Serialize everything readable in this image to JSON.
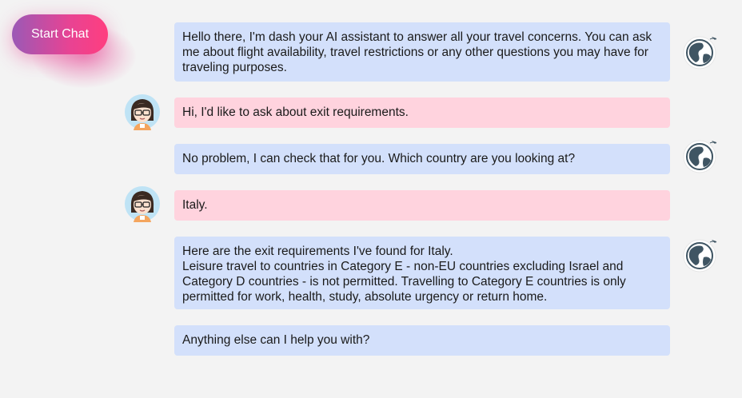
{
  "start_button": {
    "label": "Start Chat"
  },
  "messages": [
    {
      "from": "bot",
      "text": "Hello there, I'm dash your AI assistant to answer all your travel concerns. You can ask me about flight availability, travel restrictions or any other questions you may have for traveling purposes."
    },
    {
      "from": "user",
      "text": "Hi, I'd like to ask about exit requirements."
    },
    {
      "from": "bot",
      "text": "No problem, I can check that for you. Which country are you looking at?"
    },
    {
      "from": "user",
      "text": "Italy."
    },
    {
      "from": "bot",
      "text": "Here are the exit requirements I've found for Italy.\nLeisure travel to countries in Category E - non-EU countries excluding Israel and Category D countries - is not permitted. Travelling to Category E countries is only permitted for work, health, study, absolute urgency or return home."
    },
    {
      "from": "bot",
      "text": "Anything else can I help you with?"
    }
  ],
  "icons": {
    "bot_avatar": "globe-plane-icon",
    "user_avatar": "girl-with-glasses-icon"
  },
  "colors": {
    "bot_bubble": "#d3e0fb",
    "user_bubble": "#ffd3de",
    "button_start": "#9b59b6",
    "button_end": "#ff3e7f"
  }
}
